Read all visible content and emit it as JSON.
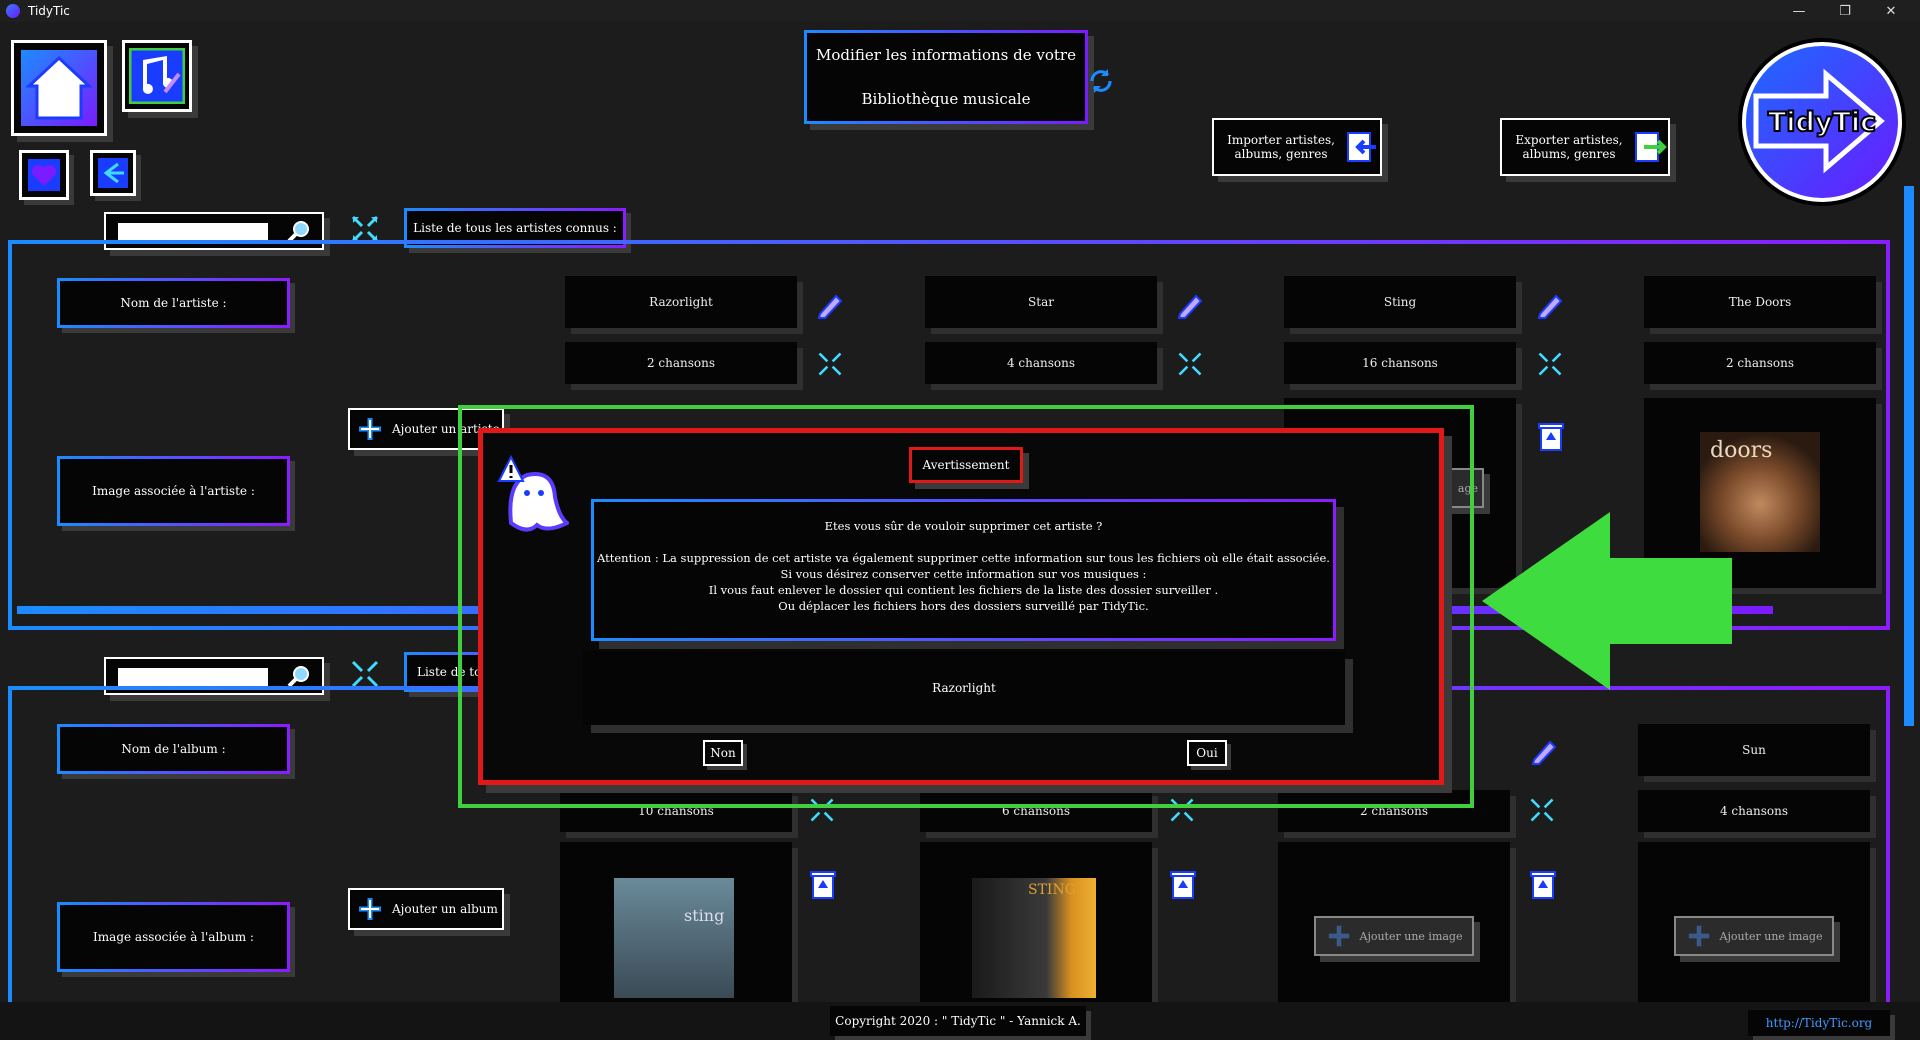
{
  "window": {
    "title": "TidyTic",
    "minimize": "—",
    "restore": "❐",
    "close": "✕"
  },
  "header": {
    "title_line1": "Modifier les informations de votre",
    "title_line2": "Bibliothèque musicale",
    "import_label": "Importer artistes, albums, genres",
    "export_label": "Exporter artistes, albums, genres",
    "logo_text": "TidyTic"
  },
  "artists_section": {
    "list_label": "Liste de tous les artistes connus :",
    "name_label": "Nom de l'artiste :",
    "image_label": "Image associée à l'artiste :",
    "add_button": "Ajouter un artiste",
    "artists": [
      {
        "name": "Razorlight",
        "songs": "2 chansons"
      },
      {
        "name": "Star",
        "songs": "4 chansons"
      },
      {
        "name": "Sting",
        "songs": "16 chansons"
      },
      {
        "name": "The Doors",
        "songs": "2 chansons"
      }
    ],
    "add_image_partial": "age"
  },
  "albums_section": {
    "list_label": "Liste de tous les albums connus :",
    "name_label": "Nom de l'album :",
    "image_label": "Image associée à l'album :",
    "add_button": "Ajouter un album",
    "albums": [
      {
        "name": "",
        "songs": "10 chansons"
      },
      {
        "name": "",
        "songs": "6 chansons"
      },
      {
        "name": "",
        "songs": "2 chansons"
      },
      {
        "name": "Sun",
        "songs": "4 chansons"
      }
    ],
    "add_image": "Ajouter une image",
    "album_cover_text": "sting",
    "album_cover_text2": "STING"
  },
  "dialog": {
    "title": "Avertissement",
    "question": "Etes vous sûr de vouloir supprimer cet artiste ?",
    "line1": "Attention : La suppression de cet artiste va également supprimer cette information sur tous les fichiers où elle était associée.",
    "line2": "Si vous désirez conserver cette information sur vos musiques :",
    "line3": "Il vous faut enlever le dossier qui contient les fichiers de la liste des dossier surveiller .",
    "line4": "Ou déplacer les fichiers hors des dossiers surveillé par TidyTic.",
    "artist": "Razorlight",
    "no": "Non",
    "yes": "Oui"
  },
  "footer": {
    "copyright": "Copyright 2020 : \" TidyTic \" - Yannick A.",
    "link": "http://TidyTic.org"
  },
  "colors": {
    "accent_blue": "#1c8bff",
    "accent_purple": "#7a1cff",
    "warning_red": "#e01818",
    "highlight_green": "#3fcf3f"
  }
}
